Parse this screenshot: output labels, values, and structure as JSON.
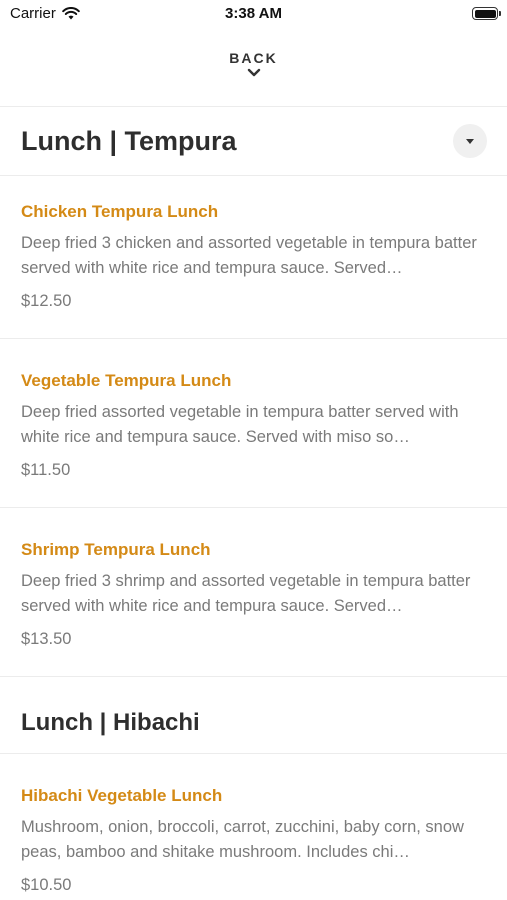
{
  "status_bar": {
    "carrier": "Carrier",
    "time": "3:38 AM",
    "wifi_icon": "wifi-icon",
    "battery_icon": "battery-icon"
  },
  "nav": {
    "back_label": "BACK",
    "back_icon": "chevron-down-icon"
  },
  "sections": [
    {
      "title": "Lunch | Tempura",
      "dropdown_icon": "caret-down-icon",
      "items": [
        {
          "name": "Chicken Tempura Lunch",
          "description": "Deep fried 3 chicken and assorted vegetable in tempura batter served with white rice and tempura sauce. Served…",
          "price": "$12.50"
        },
        {
          "name": "Vegetable Tempura Lunch",
          "description": "Deep fried assorted vegetable in tempura batter served with white rice and tempura sauce. Served with miso so…",
          "price": "$11.50"
        },
        {
          "name": "Shrimp Tempura Lunch",
          "description": "Deep fried 3 shrimp and assorted vegetable in tempura batter served with white rice and tempura sauce. Served…",
          "price": "$13.50"
        }
      ]
    },
    {
      "title": "Lunch | Hibachi",
      "items": [
        {
          "name": "Hibachi Vegetable Lunch",
          "description": "Mushroom, onion, broccoli, carrot, zucchini, baby corn, snow peas, bamboo and shitake mushroom. Includes chi…",
          "price": "$10.50"
        }
      ]
    }
  ],
  "colors": {
    "accent": "#d48a16",
    "text_primary": "#2e2e2e",
    "text_secondary": "#7a7a7a",
    "divider": "#ececec"
  }
}
